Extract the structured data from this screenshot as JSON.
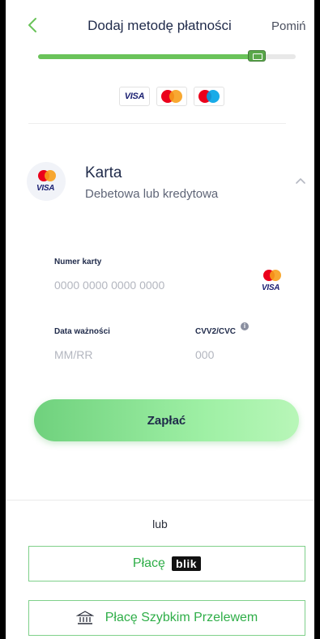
{
  "header": {
    "title": "Dodaj metodę płatności",
    "skip_label": "Pomiń"
  },
  "progress": {
    "value_percent": 85
  },
  "accepted_brands": [
    "VISA",
    "Mastercard",
    "Maestro"
  ],
  "card_method": {
    "title": "Karta",
    "subtitle": "Debetowa lub kredytowa",
    "logo_text": "VISA"
  },
  "form": {
    "card_number": {
      "label": "Numer karty",
      "value": "",
      "placeholder": "0000 0000 0000 0000",
      "brand_text": "VISA"
    },
    "expiry": {
      "label": "Data ważności",
      "value": "",
      "placeholder": "MM/RR"
    },
    "cvv": {
      "label": "CVV2/CVC",
      "value": "",
      "placeholder": "000",
      "info_glyph": "i"
    }
  },
  "pay_button": {
    "label": "Zapłać"
  },
  "alternatives": {
    "or_label": "lub",
    "blik": {
      "label": "Płacę",
      "logo_text": "blik"
    },
    "transfer": {
      "label": "Płacę Szybkim Przelewem"
    }
  },
  "colors": {
    "accent_green": "#6ac35a",
    "text_dark": "#1f2a4a",
    "alt_button_text": "#2fae48"
  },
  "icons": {
    "back": "chevron-left-icon",
    "collapse": "chevron-up-icon",
    "info": "info-icon",
    "bank": "bank-icon"
  }
}
